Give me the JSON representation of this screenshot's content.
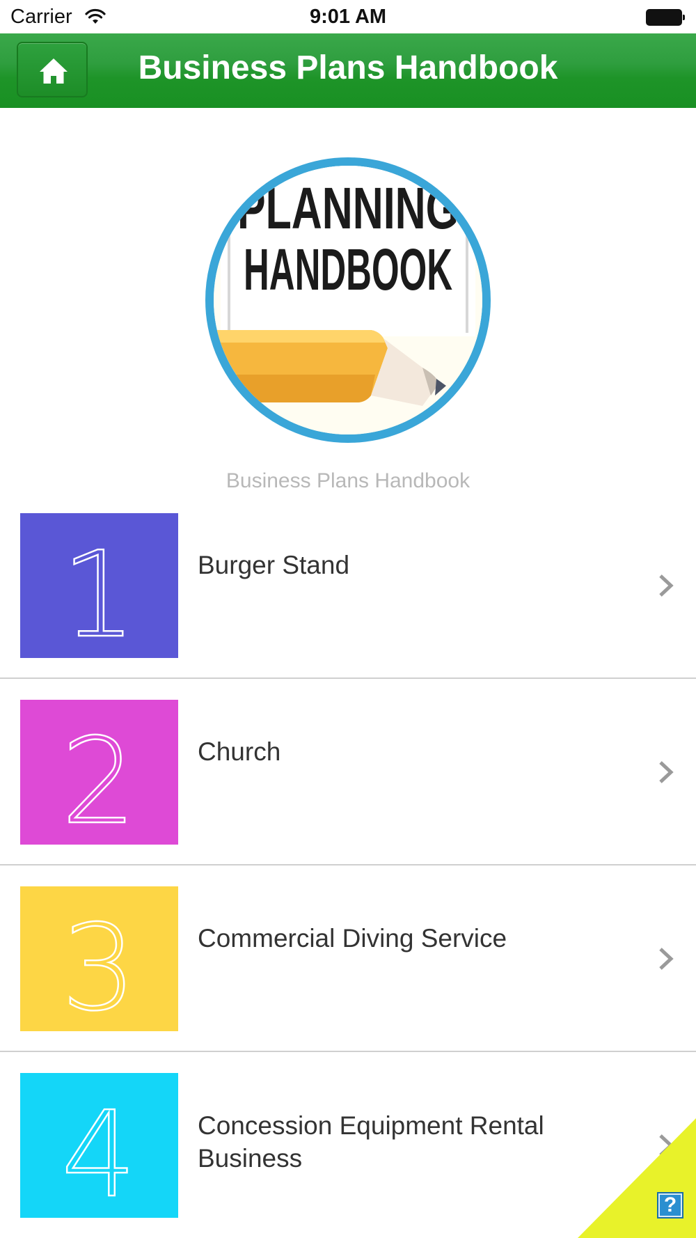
{
  "status_bar": {
    "carrier": "Carrier",
    "time": "9:01 AM"
  },
  "nav": {
    "title": "Business Plans Handbook",
    "home_icon": "home-icon",
    "bar_color": "#1e9428"
  },
  "header": {
    "logo_text_line1": "PLANNING",
    "logo_text_line2": "HANDBOOK",
    "caption": "Business Plans Handbook",
    "ring_color": "#3aa6d8"
  },
  "list": {
    "items": [
      {
        "number": "1",
        "label": "Burger Stand",
        "tile_color": "#5a57d6"
      },
      {
        "number": "2",
        "label": "Church",
        "tile_color": "#de4ad6"
      },
      {
        "number": "3",
        "label": "Commercial Diving Service",
        "tile_color": "#fdd645"
      },
      {
        "number": "4",
        "label": "Concession Equipment Rental Business",
        "tile_color": "#14d6f8"
      }
    ]
  },
  "help": {
    "label": "?",
    "corner_color": "#e8f22a"
  }
}
